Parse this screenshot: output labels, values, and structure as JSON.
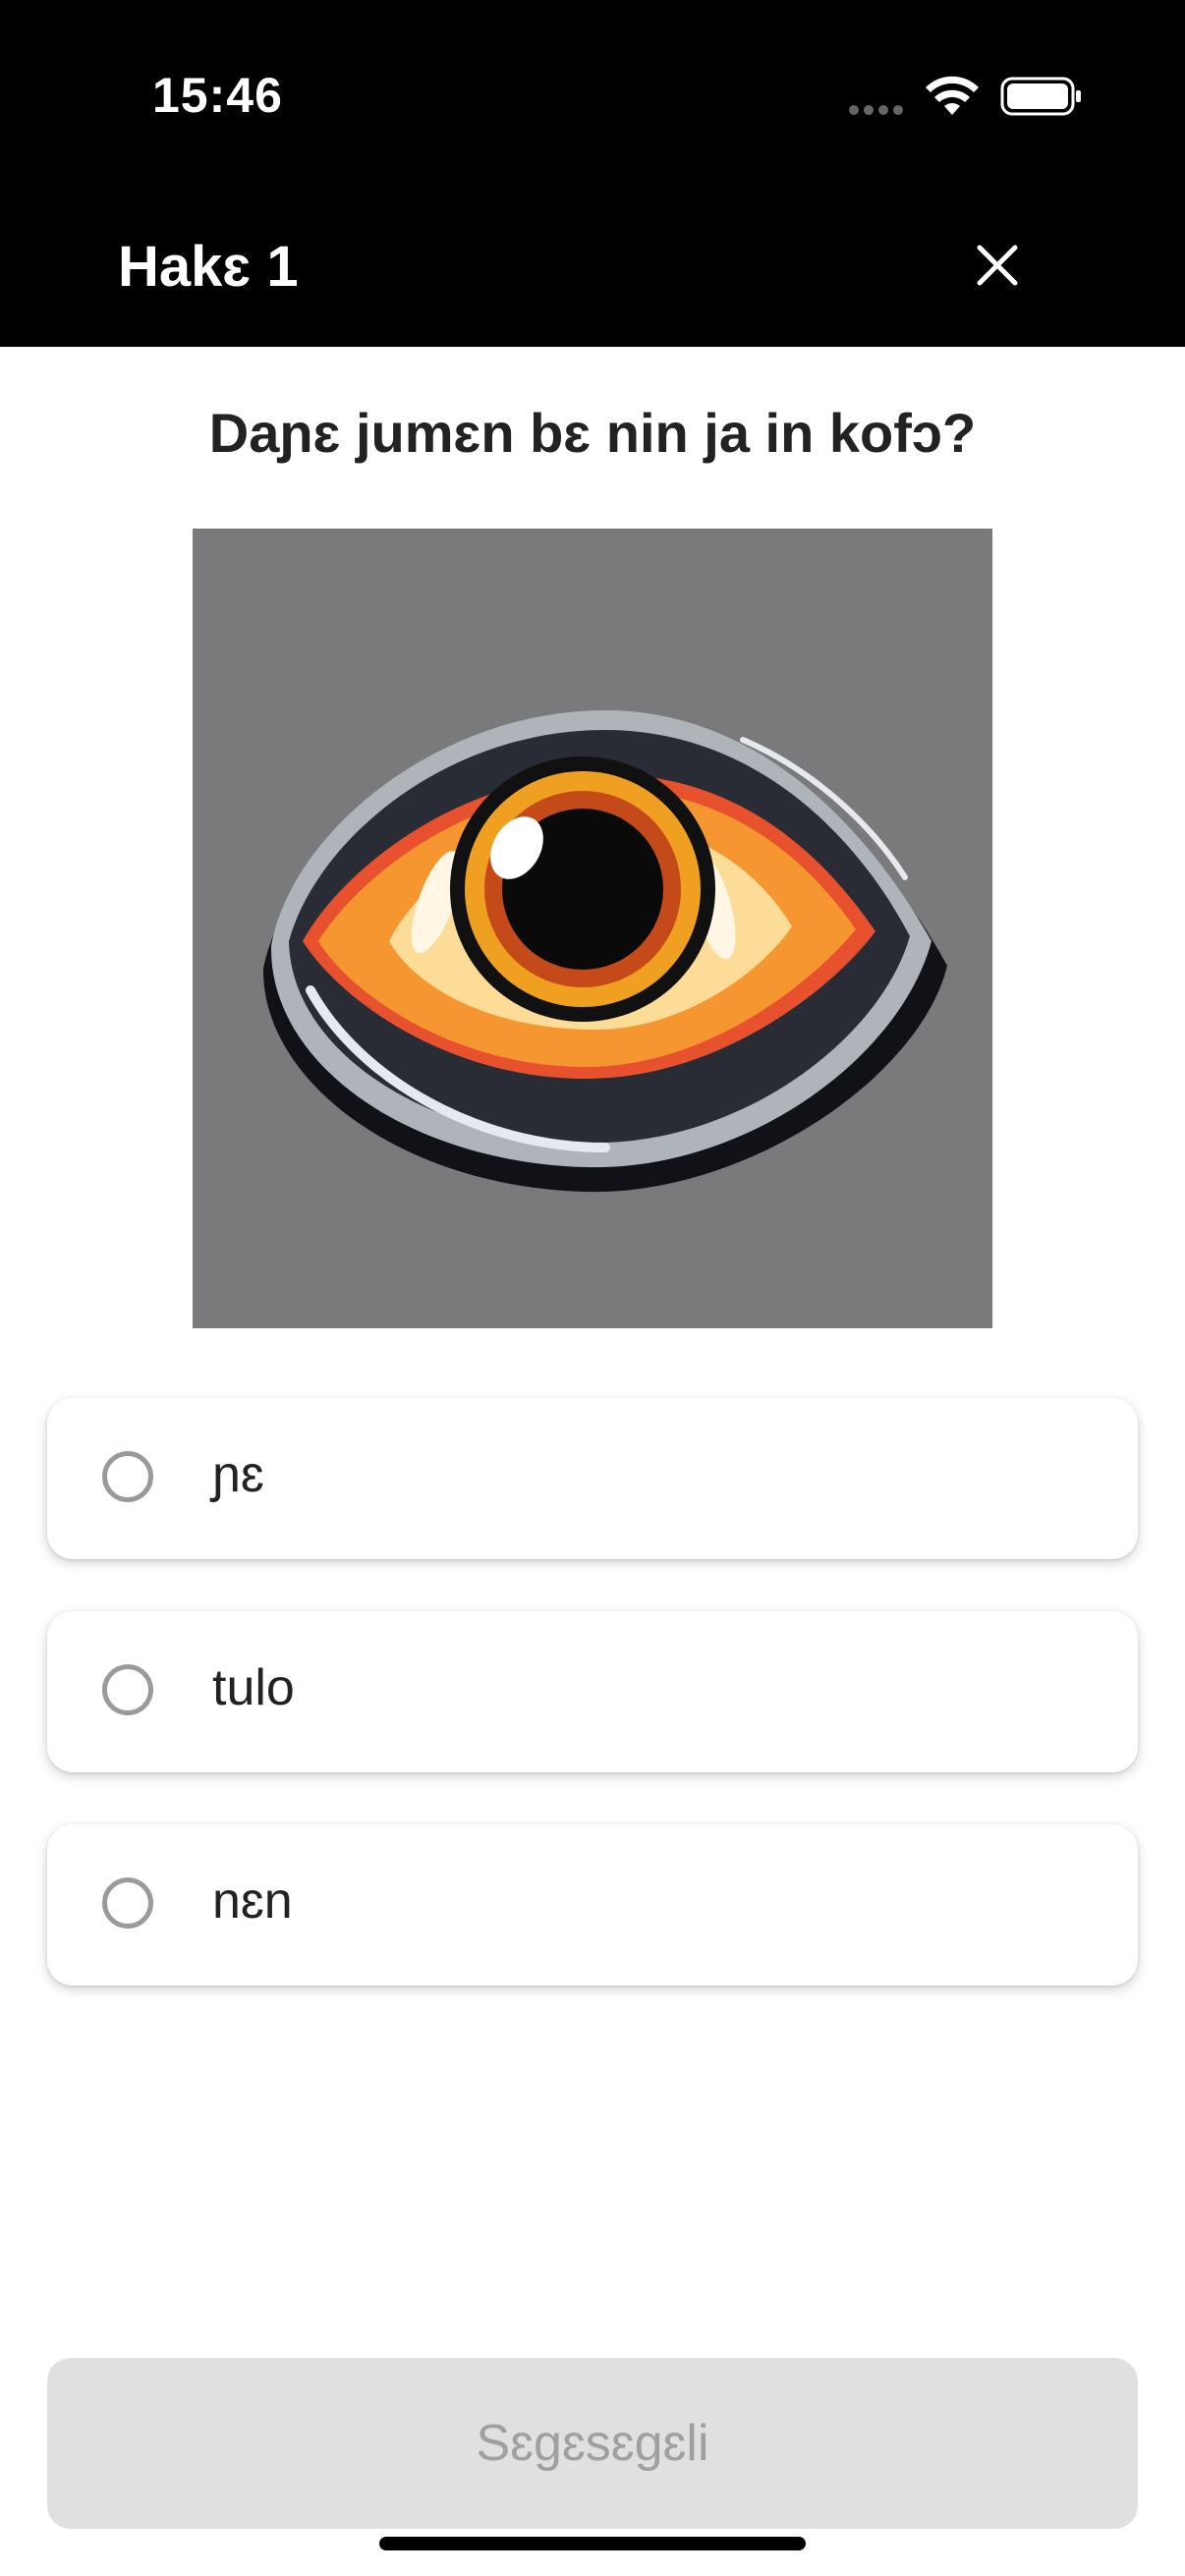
{
  "status_bar": {
    "time": "15:46",
    "icons": [
      "signal-dots-icon",
      "wifi-icon",
      "battery-icon"
    ]
  },
  "header": {
    "title": "Hakɛ 1",
    "close_icon": "close-icon"
  },
  "question": {
    "text": "Daɲɛ jumɛn bɛ nin ja in kofɔ?",
    "image": "eye-illustration"
  },
  "options": [
    {
      "label": "ɲɛ",
      "selected": false
    },
    {
      "label": "tulo",
      "selected": false
    },
    {
      "label": "nɛn",
      "selected": false
    }
  ],
  "submit": {
    "label": "Sɛgɛsɛgɛli",
    "enabled": false
  },
  "colors": {
    "header_bg": "#000000",
    "image_bg": "#7a7a7c",
    "button_disabled_bg": "#e0e0e0",
    "button_disabled_text": "#a0a0a0",
    "radio_border": "#9a9a9a"
  }
}
